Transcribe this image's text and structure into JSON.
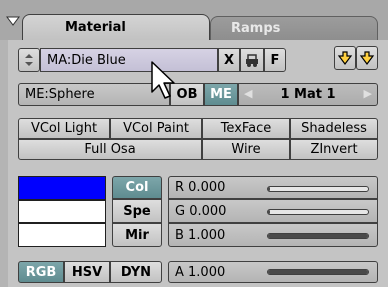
{
  "tabs": {
    "active": "Material",
    "inactive": "Ramps"
  },
  "material_row": {
    "name": "MA:Die Blue",
    "x_label": "X",
    "f_label": "F"
  },
  "mesh_row": {
    "me_name": "ME:Sphere",
    "ob_label": "OB",
    "me_label": "ME",
    "mat_count": "1 Mat 1"
  },
  "toggles": {
    "vcol_light": "VCol Light",
    "vcol_paint": "VCol Paint",
    "texface": "TexFace",
    "shadeless": "Shadeless",
    "full_osa": "Full Osa",
    "wire": "Wire",
    "zinvert": "ZInvert"
  },
  "color_buttons": {
    "col": "Col",
    "spe": "Spe",
    "mir": "Mir"
  },
  "color_mode": {
    "rgb": "RGB",
    "hsv": "HSV",
    "dyn": "DYN"
  },
  "swatch_colors": {
    "col": "#0000ff",
    "spe": "#ffffff",
    "mir": "#ffffff"
  },
  "sliders": {
    "r": {
      "label": "R 0.000",
      "value": 0.0
    },
    "g": {
      "label": "G 0.000",
      "value": 0.0
    },
    "b": {
      "label": "B 1.000",
      "value": 1.0
    },
    "a": {
      "label": "A 1.000",
      "value": 1.0
    }
  }
}
